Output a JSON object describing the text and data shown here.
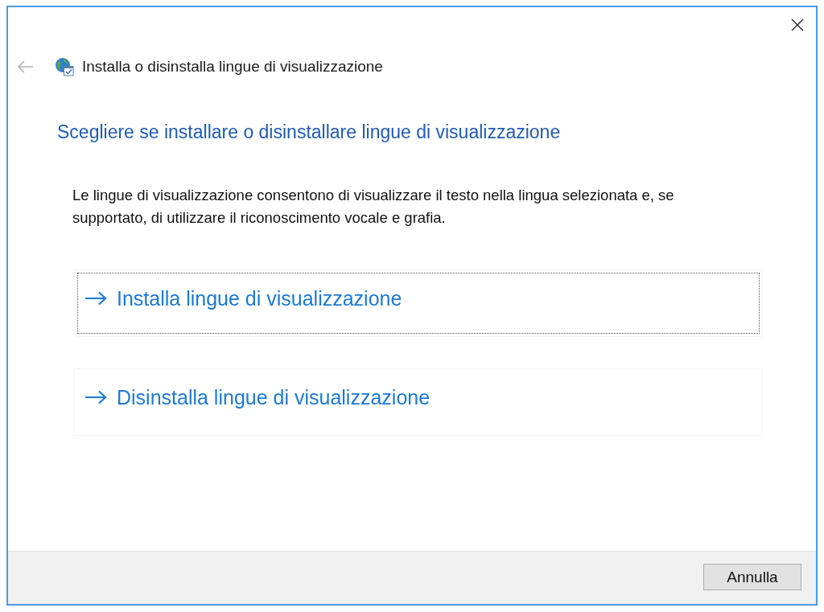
{
  "navigation": {
    "back": {
      "disabled": true
    },
    "title": "Installa o disinstalla lingue di visualizzazione"
  },
  "heading": "Scegliere se installare o disinstallare lingue di visualizzazione",
  "description": "Le lingue di visualizzazione consentono di visualizzare il testo nella lingua selezionata e, se supportato, di utilizzare il riconoscimento vocale e grafia.",
  "command_links": [
    {
      "label": "Installa lingue di visualizzazione",
      "focused": true
    },
    {
      "label": "Disinstalla lingue di visualizzazione",
      "focused": false
    }
  ],
  "buttons": [
    {
      "label": "Annulla"
    }
  ]
}
